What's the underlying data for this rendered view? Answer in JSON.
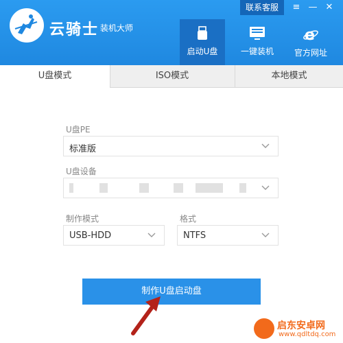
{
  "header": {
    "brand_name": "云骑士",
    "brand_sub": "装机大师",
    "support_label": "联系客服",
    "window_controls": {
      "menu": "≡",
      "minimize": "—",
      "close": "✕"
    },
    "nav": [
      {
        "label": "启动U盘",
        "icon": "usb-icon",
        "active": true
      },
      {
        "label": "一键装机",
        "icon": "monitor-icon",
        "active": false
      },
      {
        "label": "官方网址",
        "icon": "ie-icon",
        "active": false
      }
    ]
  },
  "tabs": [
    {
      "label": "U盘模式",
      "active": true
    },
    {
      "label": "ISO模式",
      "active": false
    },
    {
      "label": "本地模式",
      "active": false
    }
  ],
  "form": {
    "pe_label": "U盘PE",
    "pe_value": "标准版",
    "device_label": "U盘设备",
    "device_value": "",
    "mode_label": "制作模式",
    "mode_value": "USB-HDD",
    "format_label": "格式",
    "format_value": "NTFS"
  },
  "action": {
    "label": "制作U盘启动盘"
  },
  "watermark": {
    "text": "启东安卓网",
    "url": "www.qdltdq.com"
  },
  "colors": {
    "header": "#2b9bf0",
    "primary": "#2a91e8",
    "arrow": "#b3221a",
    "watermark": "#f26a1b"
  }
}
